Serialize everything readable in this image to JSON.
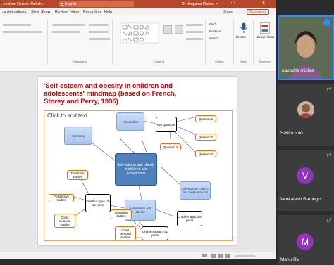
{
  "ppt": {
    "title": "...rosham Review Worksh...",
    "search_placeholder": "Search",
    "user": "Dr Nirupama Mishra",
    "menu": [
      "...s",
      "Animations",
      "Slide Show",
      "Review",
      "View",
      "Recording",
      "Help"
    ],
    "share": "Share",
    "comments": "Comments",
    "groups": {
      "paragraph": "Paragraph",
      "drawing": "Drawing",
      "editing": "Editing",
      "voice": "Voice",
      "designer": "Designer"
    },
    "ribbon_items": {
      "find": "Find",
      "replace": "Replace",
      "select": "Select",
      "dictate": "Dictate",
      "design_ideas": "Design Ideas",
      "arrange": "Arrange",
      "quick_styles": "Quick Styles"
    }
  },
  "slide": {
    "title": "'Self-esteem and obesity in children and adolescents' mindmap (based on French, Storey  and Perry, 1995)",
    "placeholder": "Click to add text",
    "nodes": {
      "summary": "Summary",
      "introduction": "Introduction",
      "key_questions": "Key questions",
      "q1": "Question 1",
      "q2": "Question 2",
      "q3": "Question 3",
      "q4": "Question 4",
      "center": "Self-esteem and obesity in children and adolescents",
      "theory": "Self-esteem: Theory and measurements",
      "children_3_8": "Children aged 3-8 years",
      "self_esteem_obesity": "Self-esteem and obesity",
      "children_7_12": "Children aged 7-12 years",
      "children_13_18": "Children aged 13-18 years",
      "treatment1": "Treatment studies",
      "treatment2": "Treatment studies",
      "prospective": "Prospective studies",
      "cross1": "Cross sectional studies",
      "cross2": "Cross sectional studies"
    }
  },
  "participants": [
    {
      "name": "navodita mishra"
    },
    {
      "name": "Savita Rao"
    },
    {
      "name": "Venkatesh Ramego...",
      "initial": "V"
    },
    {
      "name": "Manu RV",
      "initial": "M"
    }
  ]
}
